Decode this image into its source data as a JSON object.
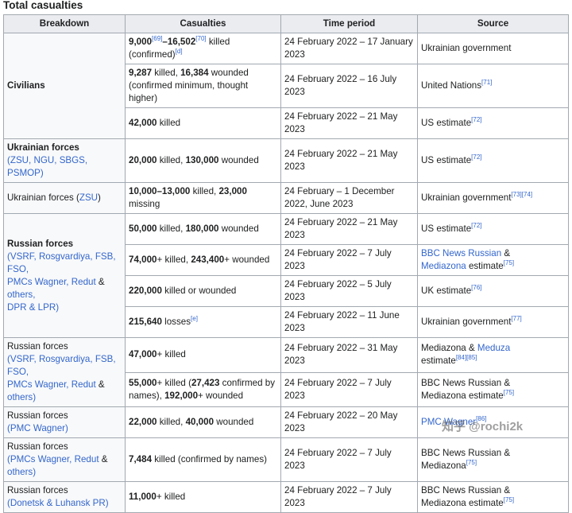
{
  "title": "Total casualties",
  "headers": {
    "breakdown": "Breakdown",
    "casualties": "Casualties",
    "period": "Time period",
    "source": "Source"
  },
  "groups": {
    "civilians": "Civilians",
    "ukr_forces": "Ukrainian forces",
    "ukr_forces_links": "(ZSU, NGU, SBGS, PSMOP)",
    "ukr_forces_zsu_pre": "Ukrainian forces (",
    "ukr_forces_zsu_link": "ZSU",
    "ukr_forces_zsu_post": ")",
    "rus_forces_bold": "Russian forces",
    "rus_forces_bold_l1": "(VSRF, Rosgvardiya, FSB, FSO,",
    "rus_forces_bold_l2": "PMCs Wagner, Redut",
    "rus_forces_bold_l2b": " &",
    "rus_forces_bold_l3": "others,",
    "rus_forces_bold_l4": "DPR & LPR)",
    "rus_forces": "Russian forces",
    "rus_forces_l1": "(VSRF, Rosgvardiya, FSB, FSO,",
    "rus_forces_l2": "PMCs Wagner, Redut",
    "rus_forces_l2b": " &",
    "rus_forces_l3": "others)",
    "rus_wagner": "Russian forces",
    "rus_wagner_link": "(PMC Wagner)",
    "rus_pmc": "Russian forces",
    "rus_pmc_l1": "(PMCs Wagner, Redut",
    "rus_pmc_l1b": " &",
    "rus_pmc_l2": "others)",
    "rus_dlpr": "Russian forces",
    "rus_dlpr_link": "(Donetsk & Luhansk PR)"
  },
  "rows": {
    "civ1": {
      "a": "9,000",
      "a_ref": "[69]",
      "dash": "–",
      "b": "16,502",
      "b_ref": "[70]",
      "txt": " killed",
      "txt2": "(confirmed)",
      "ref2": "[d]",
      "period": "24 February 2022 – 17 January 2023",
      "source": "Ukrainian government"
    },
    "civ2": {
      "a": "9,287",
      "t1": " killed, ",
      "b": "16,384",
      "t2": " wounded (confirmed minimum, thought higher)",
      "period": "24 February 2022 – 16 July 2023",
      "source": "United Nations",
      "ref": "[71]"
    },
    "civ3": {
      "a": "42,000",
      "t1": " killed",
      "period": "24 February 2022 – 21 May 2023",
      "source": "US estimate",
      "ref": "[72]"
    },
    "ukr1": {
      "a": "20,000",
      "t1": " killed, ",
      "b": "130,000",
      "t2": " wounded",
      "period": "24 February 2022 – 21 May 2023",
      "source": "US estimate",
      "ref": "[72]"
    },
    "ukr2": {
      "a": "10,000–13,000",
      "t1": " killed, ",
      "b": "23,000",
      "t2": " missing",
      "period": "24 February – 1 December 2022, June 2023",
      "source": "Ukrainian government",
      "ref": "[73][74]"
    },
    "rus1": {
      "a": "50,000",
      "t1": " killed, ",
      "b": "180,000",
      "t2": " wounded",
      "period": "24 February 2022 – 21 May 2023",
      "source": "US estimate",
      "ref": "[72]"
    },
    "rus2": {
      "a": "74,000",
      "t1": "+ killed, ",
      "b": "243,400",
      "t2": "+ wounded",
      "period": "24 February 2022 – 7 July 2023",
      "src_link1": "BBC News Russian",
      "src_amp": " &",
      "src_link2": "Mediazona",
      "src_tail": " estimate",
      "ref": "[75]"
    },
    "rus3": {
      "a": "220,000",
      "t1": " killed or wounded",
      "period": "24 February 2022 – 5 July 2023",
      "source": "UK estimate",
      "ref": "[76]"
    },
    "rus4": {
      "a": "215,640",
      "t1": " losses",
      "ref_a": "[e]",
      "period": "24 February 2022 – 11 June 2023",
      "source": "Ukrainian government",
      "ref": "[77]"
    },
    "rus5": {
      "a": "47,000",
      "t1": "+ killed",
      "period": "24 February 2022 – 31 May 2023",
      "src1": "Mediazona &",
      "src_link": "Meduza",
      "src_tail": "estimate",
      "ref": "[84][85]"
    },
    "rus6": {
      "a": "55,000",
      "t1": "+ killed (",
      "b": "27,423",
      "t2": " confirmed by names), ",
      "c": "192,000",
      "t3": "+ wounded",
      "period": "24 February 2022 – 7 July 2023",
      "src1": "BBC News Russian &",
      "src2": "Mediazona estimate",
      "ref": "[75]"
    },
    "wag": {
      "a": "22,000",
      "t1": " killed, ",
      "b": "40,000",
      "t2": " wounded",
      "period": "24 February 2022 – 20 May 2023",
      "src_link": "PMC Wagner",
      "ref": "[86]"
    },
    "pmc": {
      "a": "7,484",
      "t1": " killed (confirmed by names)",
      "period": "24 February 2022 – 7 July 2023",
      "src1": "BBC News Russian &",
      "src2": "Mediazona",
      "ref": "[75]"
    },
    "dlpr": {
      "a": "11,000",
      "t1": "+ killed",
      "period": "24 February 2022 – 7 July 2023",
      "src1": "BBC News Russian &",
      "src2": "Mediazona estimate",
      "ref": "[75]"
    }
  },
  "watermark": "知乎 @rochi2k"
}
